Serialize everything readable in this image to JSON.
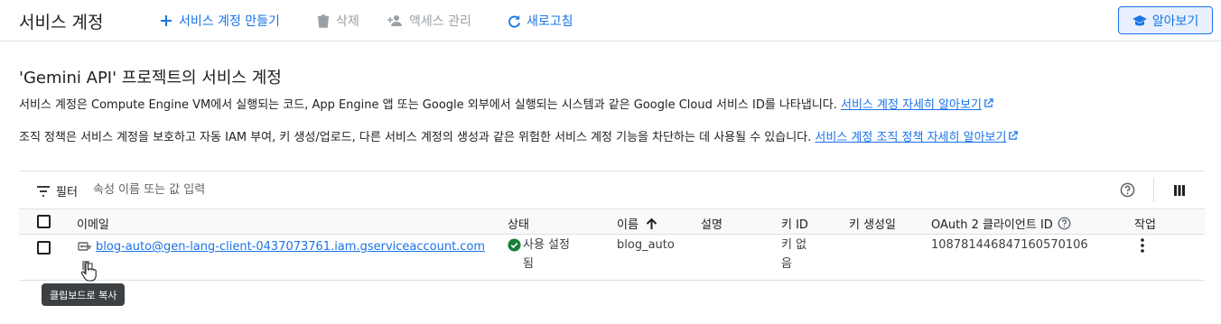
{
  "header": {
    "title": "서비스 계정",
    "create_label": "서비스 계정 만들기",
    "delete_label": "삭제",
    "access_label": "액세스 관리",
    "refresh_label": "새로고침",
    "learn_label": "알아보기"
  },
  "intro": {
    "title": "'Gemini API' 프로젝트의 서비스 계정",
    "line1_text": "서비스 계정은 Compute Engine VM에서 실행되는 코드, App Engine 앱 또는 Google 외부에서 실행되는 시스템과 같은 Google Cloud 서비스 ID를 나타냅니다. ",
    "line1_link": "서비스 계정 자세히 알아보기",
    "line2_text": "조직 정책은 서비스 계정을 보호하고 자동 IAM 부여, 키 생성/업로드, 다른 서비스 계정의 생성과 같은 위험한 서비스 계정 기능을 차단하는 데 사용될 수 있습니다. ",
    "line2_link": "서비스 계정 조직 정책 자세히 알아보기"
  },
  "filter": {
    "label": "필터",
    "placeholder": "속성 이름 또는 값 입력"
  },
  "table": {
    "columns": {
      "email": "이메일",
      "status": "상태",
      "name": "이름",
      "description": "설명",
      "key_id": "키 ID",
      "key_created": "키 생성일",
      "oauth_client_id": "OAuth 2 클라이언트 ID",
      "actions": "작업"
    },
    "rows": [
      {
        "email": "blog-auto@gen-lang-client-0437073761.iam.gserviceaccount.com",
        "status_line1": "사용 설정",
        "status_line2": "됨",
        "name": "blog_auto",
        "description": "",
        "key_id_line1": "키 없",
        "key_id_line2": "음",
        "key_created": "",
        "oauth_client_id": "108781446847160570106"
      }
    ]
  },
  "tooltip": "클립보드로 복사",
  "colors": {
    "accent": "#1a73e8",
    "success": "#188038",
    "disabled": "#9aa0a6"
  },
  "icons": [
    "plus-icon",
    "trash-icon",
    "person-add-icon",
    "refresh-icon",
    "school-icon",
    "external-link-icon",
    "filter-icon",
    "help-icon",
    "columns-icon",
    "arrow-up-icon",
    "key-icon",
    "copy-icon",
    "check-circle-icon",
    "more-vert-icon"
  ]
}
